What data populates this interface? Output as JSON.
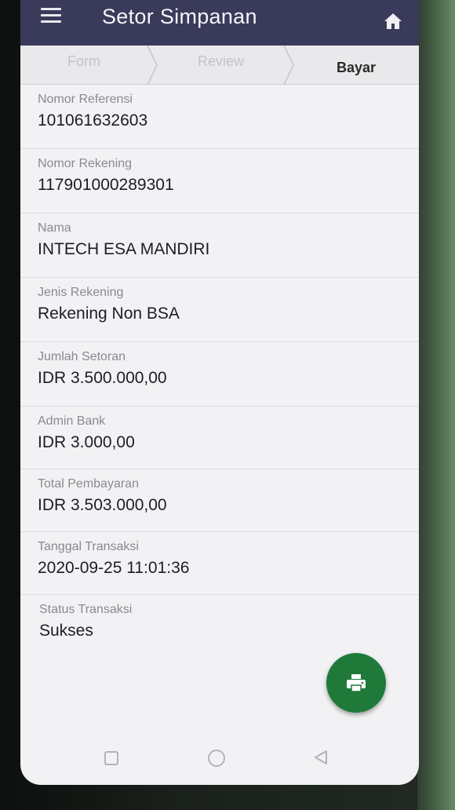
{
  "header": {
    "title": "Setor Simpanan"
  },
  "stepper": {
    "steps": [
      "Form",
      "Review",
      "Bayar"
    ]
  },
  "fields": [
    {
      "label": "Nomor Referensi",
      "value": "101061632603"
    },
    {
      "label": "Nomor Rekening",
      "value": "117901000289301"
    },
    {
      "label": "Nama",
      "value": "INTECH ESA MANDIRI"
    },
    {
      "label": "Jenis Rekening",
      "value": "Rekening Non BSA"
    },
    {
      "label": "Jumlah Setoran",
      "value": "IDR 3.500.000,00"
    },
    {
      "label": "Admin Bank",
      "value": "IDR 3.000,00"
    },
    {
      "label": "Total Pembayaran",
      "value": "IDR 3.503.000,00"
    },
    {
      "label": "Tanggal Transaksi",
      "value": "2020-09-25 11:01:36"
    },
    {
      "label": "Status Transaksi",
      "value": "Sukses"
    }
  ],
  "colors": {
    "header": "#3a3a5a",
    "fab": "#1f7a3a",
    "background": "#f2f2f4"
  },
  "icons": {
    "menu": "menu-icon",
    "home": "home-icon",
    "print": "print-icon"
  }
}
